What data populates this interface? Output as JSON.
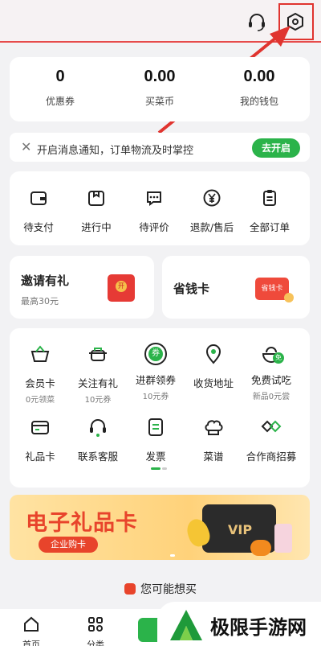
{
  "header": {
    "support_icon": "headset-icon",
    "settings_icon": "hexagon-settings-icon"
  },
  "stats": [
    {
      "value": "0",
      "label": "优惠券"
    },
    {
      "value": "0.00",
      "label": "买菜币"
    },
    {
      "value": "0.00",
      "label": "我的钱包"
    }
  ],
  "notice": {
    "text": "开启消息通知，订单物流及时掌控",
    "button": "去开启"
  },
  "orders": [
    {
      "label": "待支付",
      "icon": "wallet-icon"
    },
    {
      "label": "进行中",
      "icon": "package-icon"
    },
    {
      "label": "待评价",
      "icon": "chat-bubble-icon"
    },
    {
      "label": "退款/售后",
      "icon": "yen-circle-icon"
    },
    {
      "label": "全部订单",
      "icon": "clipboard-icon"
    }
  ],
  "promo": {
    "invite": {
      "title": "邀请有礼",
      "subtitle": "最高30元",
      "badge": "开"
    },
    "saver": {
      "title": "省钱卡",
      "badge": "省钱卡"
    }
  },
  "services": [
    {
      "label": "会员卡",
      "sub": "0元领菜",
      "icon": "basket-icon"
    },
    {
      "label": "关注有礼",
      "sub": "10元券",
      "icon": "pot-icon"
    },
    {
      "label": "进群领券",
      "sub": "10元券",
      "icon": "coupon-circle-icon",
      "badge": "券"
    },
    {
      "label": "收货地址",
      "sub": "",
      "icon": "location-pin-icon"
    },
    {
      "label": "免费试吃",
      "sub": "新品0元尝",
      "icon": "bowl-icon",
      "badge": "免"
    },
    {
      "label": "礼品卡",
      "sub": "",
      "icon": "gift-card-icon"
    },
    {
      "label": "联系客服",
      "sub": "",
      "icon": "headset-icon"
    },
    {
      "label": "发票",
      "sub": "",
      "icon": "invoice-icon"
    },
    {
      "label": "菜谱",
      "sub": "",
      "icon": "chef-hat-icon"
    },
    {
      "label": "合作商招募",
      "sub": "",
      "icon": "handshake-icon"
    }
  ],
  "banner": {
    "title": "电子礼品卡",
    "pill": "企业购卡",
    "card_text": "VIP"
  },
  "recommend": {
    "title": "您可能想买"
  },
  "bottom_nav": [
    {
      "label": "首页",
      "icon": "home-icon"
    },
    {
      "label": "分类",
      "icon": "grid-icon"
    }
  ],
  "watermark": {
    "text": "极限手游网"
  },
  "colors": {
    "accent": "#2bb34a",
    "highlight": "#e0342f",
    "banner_red": "#e8442b"
  }
}
